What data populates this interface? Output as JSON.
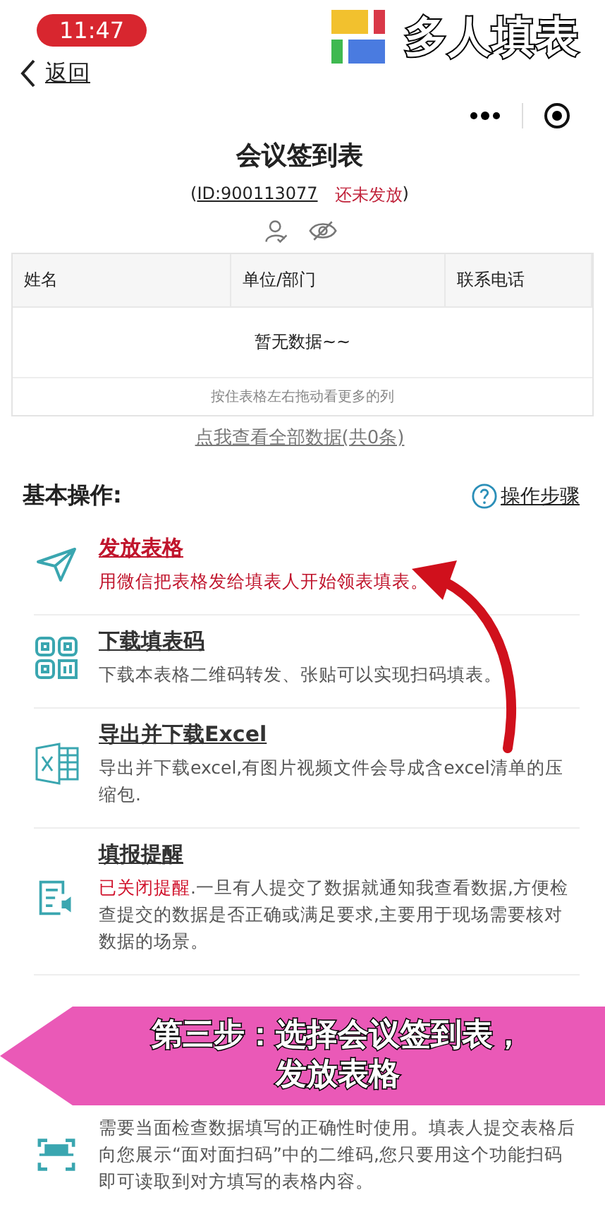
{
  "status_bar": {
    "time": "11:47"
  },
  "logo_overlay": {
    "text": "多人填表"
  },
  "nav": {
    "back_label": "返回"
  },
  "header": {
    "title": "会议签到表",
    "paren_open": "(",
    "id_text": "ID:900113077",
    "paren_close": ")",
    "status_text": "还未发放"
  },
  "table": {
    "columns": [
      "姓名",
      "单位/部门",
      "联系电话"
    ],
    "empty_text": "暂无数据~~",
    "hint": "按住表格左右拖动看更多的列"
  },
  "view_all_link": "点我查看全部数据(共0条)",
  "section": {
    "title": "基本操作:",
    "help_label": "操作步骤"
  },
  "actions": [
    {
      "kind": "send",
      "title": "发放表格",
      "accent": true,
      "description": "用微信把表格发给填表人开始领表填表。"
    },
    {
      "kind": "qr",
      "title": "下载填表码",
      "accent": false,
      "description": "下载本表格二维码转发、张贴可以实现扫码填表。"
    },
    {
      "kind": "excel",
      "title": "导出并下载Excel",
      "accent": false,
      "description": "导出并下载excel,有图片视频文件会导成含excel清单的压缩包."
    },
    {
      "kind": "reminder",
      "title": "填报提醒",
      "accent": false,
      "status_prefix": "已关闭提醒",
      "description": ".一旦有人提交了数据就通知我查看数据,方便检查提交的数据是否正确或满足要求,主要用于现场需要核对数据的场景。"
    },
    {
      "kind": "scan",
      "accent": false,
      "description": "需要当面检查数据填写的正确性时使用。填表人提交表格后向您展示“面对面扫码”中的二维码,您只要用这个功能扫码即可读取到对方填写的表格内容。"
    }
  ],
  "caption": {
    "lines": [
      "第三步：选择会议签到表，",
      "发放表格"
    ]
  }
}
